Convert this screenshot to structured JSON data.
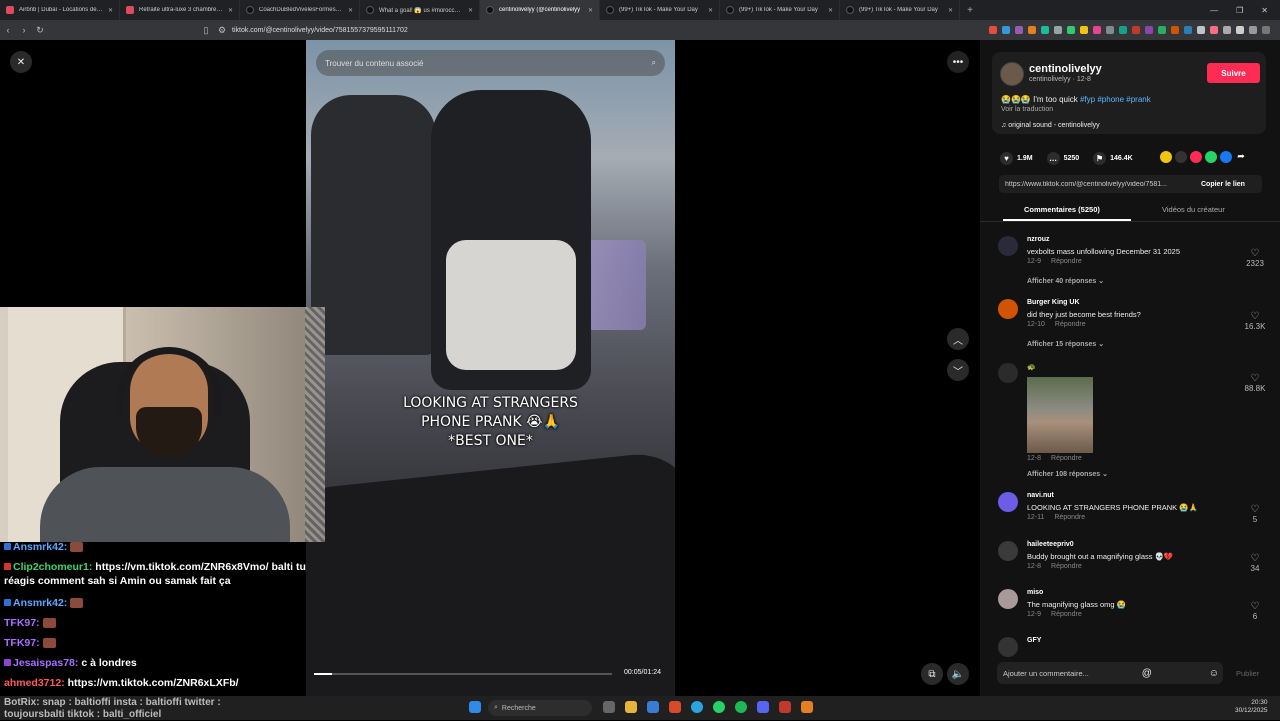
{
  "browser": {
    "tabs": [
      {
        "label": "Airbnb | Dubaï - Locations de vacanc",
        "active": false
      },
      {
        "label": "Retraite ultra-luxe 3 chambres avec",
        "active": false
      },
      {
        "label": "CoachDuBledVivelesFormes (@sam",
        "active": false
      },
      {
        "label": "What a goal! 😱 us #morocco #elka",
        "active": false
      },
      {
        "label": "centinolivelyy (@centinolivelyy",
        "active": true
      },
      {
        "label": "(99+) TikTok - Make Your Day",
        "active": false
      },
      {
        "label": "(99+) TikTok - Make Your Day",
        "active": false
      },
      {
        "label": "(99+) TikTok - Make Your Day",
        "active": false
      }
    ],
    "url": "tiktok.com/@centinolivelyy/video/7581557379595111702"
  },
  "video": {
    "search_placeholder": "Trouver du contenu associé",
    "caption": [
      "LOOKING AT STRANGERS",
      "PHONE PRANK 😭🙏",
      "*BEST ONE*"
    ],
    "time": "00:05/01:24",
    "progress": 0.06
  },
  "chat": [
    {
      "user": "Ansmrk42:",
      "msg": "",
      "color": "#5da9ff",
      "badge": "blue",
      "emote": true
    },
    {
      "user": "Clip2chomeur1:",
      "msg": "https://vm.tiktok.com/ZNR6x8Vmo/ balti tu",
      "color": "#3fd46b",
      "badge": "red",
      "emote": false
    },
    {
      "user": "",
      "msg": "réagis comment sah si Amin ou samak fait ça",
      "color": "#fff",
      "badge": "",
      "emote": false
    },
    {
      "user": "Ansmrk42:",
      "msg": "",
      "color": "#5da9ff",
      "badge": "blue",
      "emote": true
    },
    {
      "user": "TFK97:",
      "msg": "",
      "color": "#a970ff",
      "badge": "",
      "emote": true
    },
    {
      "user": "TFK97:",
      "msg": "",
      "color": "#a970ff",
      "badge": "",
      "emote": true
    },
    {
      "user": "Jesaispas78:",
      "msg": "c à londres",
      "color": "#a970ff",
      "badge": "purple",
      "emote": false
    },
    {
      "user": "ahmed3712:",
      "msg": "https://vm.tiktok.com/ZNR6xLXFb/",
      "color": "#ff5a5a",
      "badge": "",
      "emote": false
    }
  ],
  "ticker": [
    "BotRix: snap : baltioffi insta : baltioffi twitter :",
    "toujoursbalti tiktok : balti_officiel"
  ],
  "author": {
    "name": "centinolivelyy",
    "sub": "centinolivelyy · 12-8",
    "follow": "Suivre",
    "desc_prefix": "😭😭😭 I'm too quick ",
    "tags": [
      "#fyp",
      "#phone",
      "#prank"
    ],
    "translate": "Voir la traduction",
    "sound": "original sound - centinolivelyy"
  },
  "stats": {
    "likes": "1.9M",
    "comments": "5250",
    "saves": "146.4K"
  },
  "share": {
    "link": "https://www.tiktok.com/@centinolivelyy/video/7581...",
    "copy": "Copier le lien"
  },
  "panel_tabs": {
    "comments": "Commentaires (5250)",
    "creator": "Vidéos du créateur"
  },
  "comments": [
    {
      "name": "nzrouz",
      "text": "vexbolts mass unfollowing December 31 2025",
      "date": "12-9",
      "reply": "Répondre",
      "likes": "2323",
      "more": "Afficher 40 réponses ⌄"
    },
    {
      "name": "Burger King UK",
      "text": "did they just become best friends?",
      "date": "12-10",
      "reply": "Répondre",
      "likes": "16.3K",
      "more": "Afficher 15 réponses ⌄"
    },
    {
      "name": "",
      "text": "",
      "date": "12-8",
      "reply": "Répondre",
      "likes": "88.8K",
      "more": "Afficher 108 réponses ⌄"
    },
    {
      "name": "navi.nut",
      "text": "LOOKING AT STRANGERS PHONE PRANK 😭🙏",
      "date": "12-11",
      "reply": "Répondre",
      "likes": "5",
      "more": ""
    },
    {
      "name": "haileeteepriv0",
      "text": "Buddy brought out a magnifying glass 💀💔",
      "date": "12-8",
      "reply": "Répondre",
      "likes": "34",
      "more": ""
    },
    {
      "name": "miso",
      "text": "The magnifying glass omg 😭",
      "date": "12-9",
      "reply": "Répondre",
      "likes": "6",
      "more": ""
    },
    {
      "name": "GFY",
      "text": "",
      "date": "",
      "reply": "",
      "likes": "",
      "more": ""
    }
  ],
  "comment_input": {
    "placeholder": "Ajouter un commentaire...",
    "publish": "Publier"
  },
  "taskbar": {
    "search": "Recherche",
    "time": "20:30",
    "date": "30/12/2025"
  }
}
